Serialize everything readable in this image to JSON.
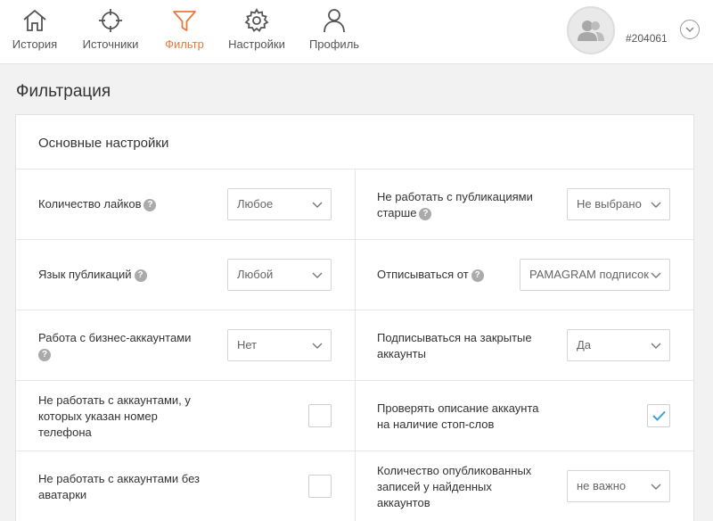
{
  "nav": {
    "items": [
      {
        "label": "История",
        "icon": "home-icon"
      },
      {
        "label": "Источники",
        "icon": "crosshair-icon"
      },
      {
        "label": "Фильтр",
        "icon": "filter-icon",
        "active": true
      },
      {
        "label": "Настройки",
        "icon": "gear-icon"
      },
      {
        "label": "Профиль",
        "icon": "user-icon"
      }
    ]
  },
  "user": {
    "id": "#204061"
  },
  "page": {
    "title": "Фильтрация"
  },
  "card": {
    "title": "Основные настройки"
  },
  "colors": {
    "accent": "#e8793c",
    "check": "#3d9fd6"
  },
  "rows": [
    {
      "left": {
        "label": "Количество лайков",
        "help": "?",
        "control": "select",
        "value": "Любое"
      },
      "right": {
        "label": "Не работать с публикациями старше",
        "help": "?",
        "control": "select",
        "value": "Не выбрано"
      }
    },
    {
      "left": {
        "label": "Язык публикаций",
        "help": "?",
        "control": "select",
        "value": "Любой"
      },
      "right": {
        "label": "Отписываться от",
        "help": "?",
        "control": "select",
        "value": "PAMAGRAM подписок"
      }
    },
    {
      "left": {
        "label": "Работа с бизнес-аккаунтами",
        "help": "?",
        "control": "select",
        "value": "Нет"
      },
      "right": {
        "label": "Подписываться на закрытые аккаунты",
        "control": "select",
        "value": "Да"
      }
    },
    {
      "left": {
        "label": "Не работать с аккаунтами, у которых указан номер телефона",
        "control": "checkbox",
        "checked": false
      },
      "right": {
        "label": "Проверять описание аккаунта на наличие стоп-слов",
        "control": "checkbox",
        "checked": true
      }
    },
    {
      "left": {
        "label": "Не работать с аккаунтами без аватарки",
        "control": "checkbox",
        "checked": false
      },
      "right": {
        "label": "Количество опубликованных записей у найденных аккаунтов",
        "control": "select",
        "value": "не важно"
      }
    }
  ]
}
